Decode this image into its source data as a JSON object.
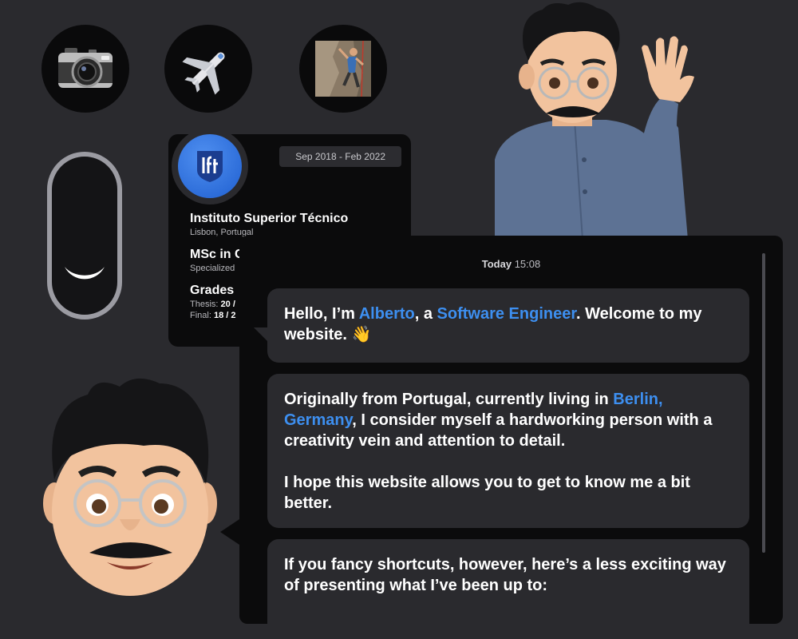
{
  "interests": [
    {
      "name": "camera-icon"
    },
    {
      "name": "airplane-icon"
    },
    {
      "name": "climbing-icon"
    }
  ],
  "theme_toggle": {
    "icon": "moon-icon",
    "state": "dark"
  },
  "education": {
    "date": "Sep 2018 - Feb 2022",
    "school": "Instituto Superior Técnico",
    "location": "Lisbon, Portugal",
    "degree": "MSc in C",
    "specialization": "Specialized",
    "grades_title": "Grades",
    "thesis_label": "Thesis:",
    "thesis_value": "20 /",
    "final_label": "Final:",
    "final_value": "18 / 2"
  },
  "chat": {
    "day": "Today",
    "time": "15:08",
    "messages": {
      "m1": {
        "p1": "Hello, I’m ",
        "name": "Alberto",
        "p2": ", a ",
        "role": "Software Engineer",
        "p3": ". Welcome to my website. 👋"
      },
      "m2": {
        "p1": "Originally from Portugal, currently living in ",
        "city": "Berlin, Germany",
        "p2": ", I consider myself a hardworking person with a creativity vein and attention to detail.",
        "para2": "I hope this website allows you to get to know me a bit better."
      },
      "m3": {
        "text": "If you fancy shortcuts, however, here’s a less exciting way of presenting what I’ve been up to:"
      }
    }
  },
  "colors": {
    "accent": "#3d8ff0",
    "background": "#2a2a2e",
    "card": "#0b0b0c",
    "bubble": "#2a2a2e"
  }
}
